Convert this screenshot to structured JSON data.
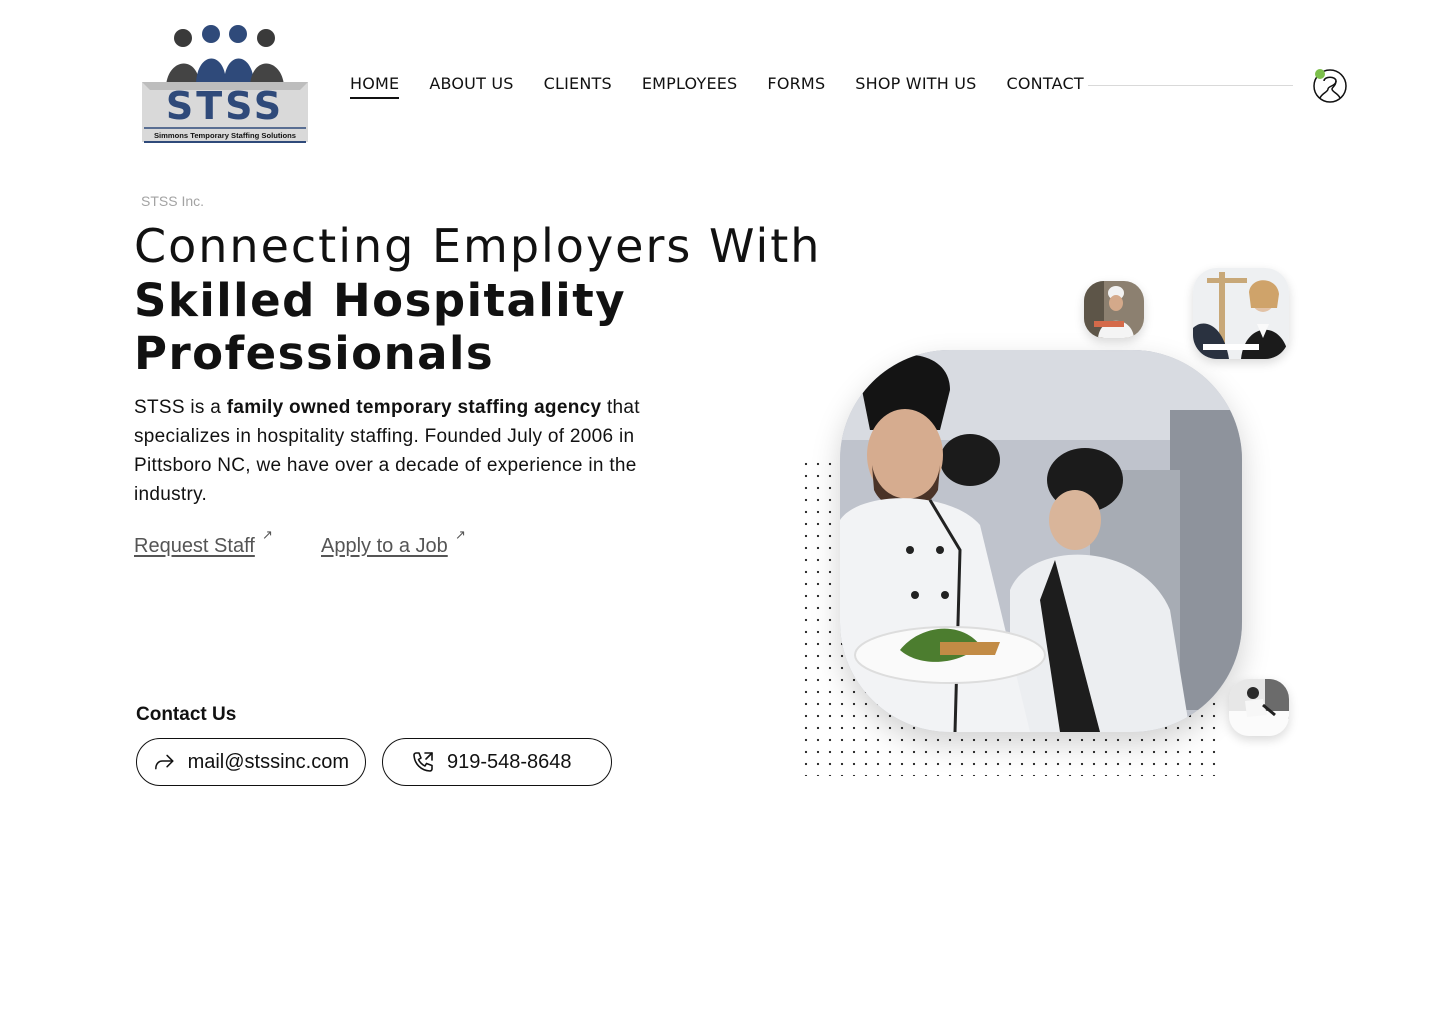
{
  "brand": {
    "logo_text": "STSS",
    "logo_tagline": "Simmons Temporary Staffing Solutions",
    "colors": {
      "logo_blue": "#2f4a7a",
      "logo_gray": "#9a9a9a",
      "online_dot": "#7cbf4b"
    }
  },
  "nav": {
    "items": [
      {
        "label": "HOME",
        "active": true
      },
      {
        "label": "ABOUT US"
      },
      {
        "label": "CLIENTS"
      },
      {
        "label": "EMPLOYEES"
      },
      {
        "label": "FORMS"
      },
      {
        "label": "SHOP WITH US"
      },
      {
        "label": "CONTACT"
      }
    ],
    "user_icon": "user-account-icon"
  },
  "hero": {
    "eyebrow": "STSS Inc.",
    "headline_line1": "Connecting Employers With",
    "headline_line2": "Skilled Hospitality",
    "headline_line3": "Professionals",
    "intro_prefix": "STSS is a ",
    "intro_bold": "family owned temporary staffing agency",
    "intro_suffix": " that specializes in hospitality staffing. Founded July of 2006 in Pittsboro NC, we have over a decade of experience in the industry.",
    "cta_request": "Request Staff",
    "cta_apply": "Apply to a Job",
    "cta_arrow": "↗"
  },
  "contact": {
    "title": "Contact Us",
    "email": "mail@stssinc.com",
    "phone": "919-548-8648",
    "email_icon": "share-arrow-icon",
    "phone_icon": "phone-call-icon"
  }
}
